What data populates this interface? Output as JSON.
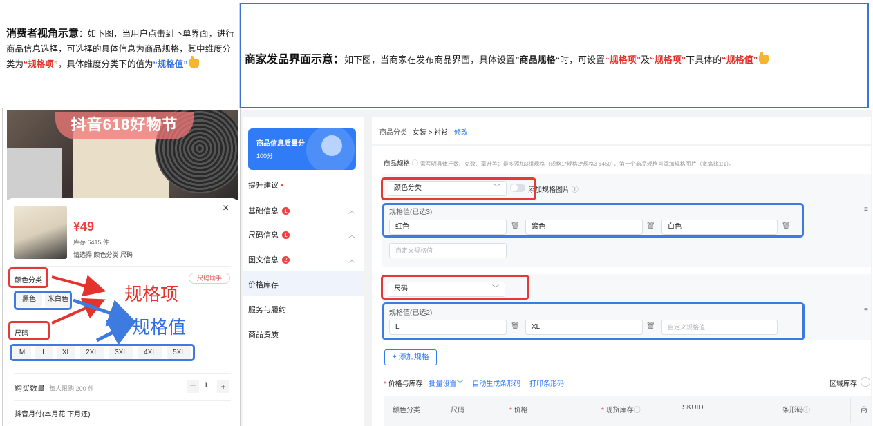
{
  "left_header": {
    "title": "消费者视角示意",
    "text1": "：如下图，当用户点击到下单界面，进行商品信息选择，可选择的具体信息为商品规格，其中维度分类为",
    "hl1": "“规格项”",
    "text2": "，具体维度分类下的值为",
    "hl2": "“规格值”"
  },
  "right_header": {
    "title": "商家发品界面示意：",
    "text1": "如下图，当商家在发布商品界面，具体设置",
    "bold1": "”商品规格“",
    "text2": "时，可设置",
    "hl1": "“规格项”",
    "text3": "及",
    "hl2": "“规格项”",
    "text4": "下具体的",
    "hl3": "“规格值”"
  },
  "consumer": {
    "banner": "抖音618好物节",
    "price": "¥49",
    "stock": "库存 6415 件",
    "hint": "请选择 颜色分类 尺码",
    "close": "×",
    "group1_label": "颜色分类",
    "size_helper": "尺码助手",
    "colors": [
      "黑色",
      "米白色"
    ],
    "group2_label": "尺码",
    "sizes": [
      "M",
      "L",
      "XL",
      "2XL",
      "3XL",
      "4XL",
      "5XL"
    ],
    "qty_label": "购买数量",
    "qty_limit": "每人限购 200 件",
    "qty_minus": "－",
    "qty_value": "1",
    "qty_plus": "+",
    "pay_label": "抖音月付(本月花 下月还)",
    "annot_item": "规格项",
    "annot_value": "规格值"
  },
  "merchant": {
    "quality_title": "商品信息质量分",
    "quality_score": "100分",
    "suggest": "提升建议",
    "nav": [
      {
        "label": "基础信息",
        "badge": "1"
      },
      {
        "label": "尺码信息",
        "badge": "1"
      },
      {
        "label": "图文信息",
        "badge": "2"
      },
      {
        "label": "价格库存",
        "badge": ""
      },
      {
        "label": "服务与履约",
        "badge": ""
      },
      {
        "label": "商品资质",
        "badge": ""
      }
    ],
    "category_label": "商品分类",
    "category_path": "女装 > 衬衫",
    "category_edit": "修改",
    "spec_title": "商品规格",
    "spec_desc": "需写明具体斤数、克数、毫升等；最多添加3组规格（规格1*规格2*规格3 ≤450），第一个商品规格可添加规格图片（宽高比1:1）。",
    "spec1_select": "颜色分类",
    "spec1_toggle": "添加规格图片",
    "spec1_values_label": "规格值(已选3)",
    "spec1_values": [
      "红色",
      "紫色",
      "白色"
    ],
    "custom_placeholder": "自定义规格值",
    "spec2_select": "尺码",
    "spec2_values_label": "规格值(已选2)",
    "spec2_values": [
      "L",
      "XL"
    ],
    "add_spec": "+ 添加规格",
    "price_stock_label": "价格与库存",
    "batch": "批量设置",
    "auto_barcode": "自动生成条形码",
    "print_barcode": "打印条形码",
    "region_stock": "区域库存",
    "table_headers": [
      "颜色分类",
      "尺码",
      "价格",
      "现货库存",
      "SKUID",
      "条形码",
      "商"
    ]
  },
  "colors": {
    "red": "#e5322d",
    "blue": "#2f6fe0",
    "primary": "#2f7cf6"
  }
}
